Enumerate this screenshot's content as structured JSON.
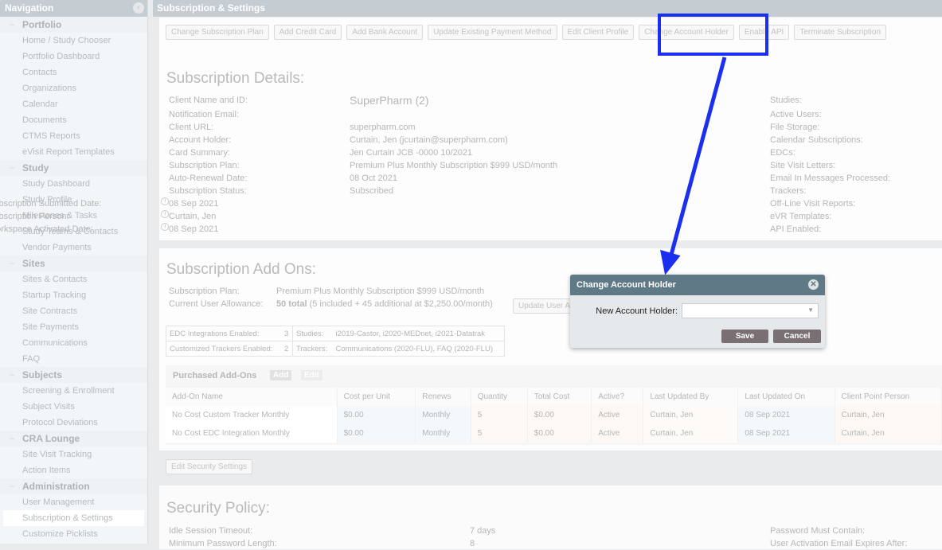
{
  "nav": {
    "title": "Navigation",
    "groups": [
      {
        "label": "Portfolio",
        "items": [
          "Home / Study Chooser",
          "Portfolio Dashboard",
          "Contacts",
          "Organizations",
          "Calendar",
          "Documents",
          "CTMS Reports",
          "eVisit Report Templates"
        ]
      },
      {
        "label": "Study",
        "items": [
          "Study Dashboard",
          "Study Profile",
          "Milestones & Tasks",
          "Study Teams & Contacts",
          "Vendor Payments"
        ]
      },
      {
        "label": "Sites",
        "items": [
          "Sites & Contacts",
          "Startup Tracking",
          "Site Contracts",
          "Site Payments",
          "Communications",
          "FAQ"
        ]
      },
      {
        "label": "Subjects",
        "items": [
          "Screening & Enrollment",
          "Subject Visits",
          "Protocol Deviations"
        ]
      },
      {
        "label": "CRA Lounge",
        "items": [
          "Site Visit Tracking",
          "Action Items"
        ]
      },
      {
        "label": "Administration",
        "items": [
          "User Management",
          "Subscription & Settings",
          "Customize Picklists"
        ]
      }
    ]
  },
  "header": {
    "title": "Subscription & Settings"
  },
  "toolbar": [
    "Change Subscription Plan",
    "Add Credit Card",
    "Add Bank Account",
    "Update Existing Payment Method",
    "Edit Client Profile",
    "Change Account Holder",
    "Enable API",
    "Terminate Subscription"
  ],
  "details": {
    "title": "Subscription Details:",
    "rows": [
      [
        "Client Name and ID:",
        "SuperPharm (2)"
      ],
      [
        "Notification Email:",
        ""
      ],
      [
        "Client URL:",
        "superpharm.com"
      ],
      [
        "Account Holder:",
        "Curtain, Jen (jcurtain@superpharm.com)"
      ],
      [
        "Card Summary:",
        "Jen Curtain JCB -0000 10/2021"
      ],
      [
        "Subscription Plan:",
        "Premium Plus Monthly Subscription $999 USD/month"
      ],
      [
        "Auto-Renewal Date:",
        "08 Oct 2021"
      ],
      [
        "Subscription Status:",
        "Subscribed"
      ],
      [
        "Subscription Submitted Date:",
        "08 Sep 2021"
      ],
      [
        "Subscription Person:",
        "Curtain, Jen"
      ],
      [
        "Workspace Activated Date:",
        "08 Sep 2021"
      ]
    ],
    "right": [
      "Studies:",
      "Active Users:",
      "File Storage:",
      "Calendar Subscriptions:",
      "EDCs:",
      "Site Visit Letters:",
      "Email In Messages Processed:",
      "Trackers:",
      "Off-Line Visit Reports:",
      "eVR Templates:",
      "API Enabled:"
    ]
  },
  "addons": {
    "title": "Subscription Add Ons:",
    "plan_label": "Subscription Plan:",
    "plan": "Premium Plus Monthly Subscription $999 USD/month",
    "allow_label": "Current User Allowance:",
    "allow_bold": "50 total",
    "allow_rest": "(5 included + 45 additional at $2,250.00/month)",
    "update_btn": "Update User Allowance",
    "mini": [
      [
        "EDC Integrations Enabled:",
        "3",
        "Studies:",
        "i2019-Castor, i2020-MEDnet, i2021-Datatrak"
      ],
      [
        "Customized Trackers Enabled:",
        "2",
        "Trackers:",
        "Communications (2020-FLU), FAQ (2020-FLU)"
      ]
    ],
    "purchased": "Purchased Add-Ons",
    "add": "Add",
    "edit": "Edit",
    "columns": [
      "Add-On Name",
      "Cost per Unit",
      "Renews",
      "Quantity",
      "Total Cost",
      "Active?",
      "Last Updated By",
      "Last Updated On",
      "Client Point Person"
    ],
    "rows": [
      [
        "No Cost Custom Tracker Monthly",
        "$0.00",
        "Monthly",
        "5",
        "$0.00",
        "Active",
        "Curtain, Jen",
        "08 Sep 2021",
        "Curtain, Jen"
      ],
      [
        "No Cost EDC Integration Monthly",
        "$0.00",
        "Monthly",
        "5",
        "$0.00",
        "Active",
        "Curtain, Jen",
        "08 Sep 2021",
        "Curtain, Jen"
      ]
    ]
  },
  "security": {
    "edit_btn": "Edit Security Settings",
    "title": "Security Policy:",
    "rows": [
      [
        "Idle Session Timeout:",
        "7 days"
      ],
      [
        "Minimum Password Length:",
        "8"
      ]
    ],
    "right": [
      "Password Must Contain:",
      "User Activation Email Expires After:"
    ]
  },
  "modal": {
    "title": "Change Account Holder",
    "field_label": "New Account Holder:",
    "value": "",
    "save": "Save",
    "cancel": "Cancel"
  },
  "annotation_color": "#1a2ff0"
}
